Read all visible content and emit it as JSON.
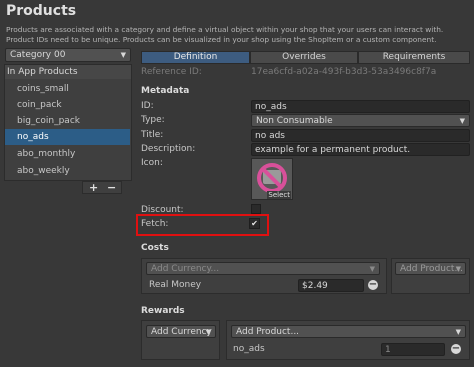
{
  "header": {
    "title": "Products",
    "description": "Products are associated with a category and define a virtual object within your shop that your users can interact with. Product IDs need to be unique. Products can be visualized in your shop using the ShopItem or a custom component."
  },
  "sidebar": {
    "category_value": "Category 00",
    "list_header": "In App Products",
    "items": [
      {
        "label": "coins_small"
      },
      {
        "label": "coin_pack"
      },
      {
        "label": "big_coin_pack"
      },
      {
        "label": "no_ads"
      },
      {
        "label": "abo_monthly"
      },
      {
        "label": "abo_weekly"
      }
    ],
    "selected_index": 3,
    "add_label": "+",
    "remove_label": "−"
  },
  "tabs": [
    {
      "label": "Definition",
      "active": true
    },
    {
      "label": "Overrides",
      "active": false
    },
    {
      "label": "Requirements",
      "active": false
    }
  ],
  "reference": {
    "label": "Reference ID:",
    "value": "17ea6cfd-a02a-493f-b3d3-53a3496c8f7a"
  },
  "metadata": {
    "section_title": "Metadata",
    "id_label": "ID:",
    "id_value": "no_ads",
    "type_label": "Type:",
    "type_value": "Non Consumable",
    "title_label": "Title:",
    "title_value": "no ads",
    "description_label": "Description:",
    "description_value": "example for a permanent product.",
    "icon_label": "Icon:",
    "icon_select": "Select",
    "discount_label": "Discount:",
    "fetch_label": "Fetch:",
    "fetch_checked": "✔"
  },
  "costs": {
    "section_title": "Costs",
    "add_currency_placeholder": "Add Currency...",
    "add_product_label": "Add Product...",
    "rows": [
      {
        "label": "Real Money",
        "value": "$2.49"
      }
    ]
  },
  "rewards": {
    "section_title": "Rewards",
    "add_currency_label": "Add Currency",
    "add_product_label": "Add Product...",
    "rows": [
      {
        "label": "no_ads",
        "value": "1"
      }
    ]
  },
  "colors": {
    "accent": "#3d5c80",
    "selection": "#2c5d87",
    "highlight": "#e01010"
  },
  "icons": [
    "dropdown-arrow-icon",
    "no-ads-product-icon",
    "checkmark-icon",
    "remove-icon"
  ]
}
